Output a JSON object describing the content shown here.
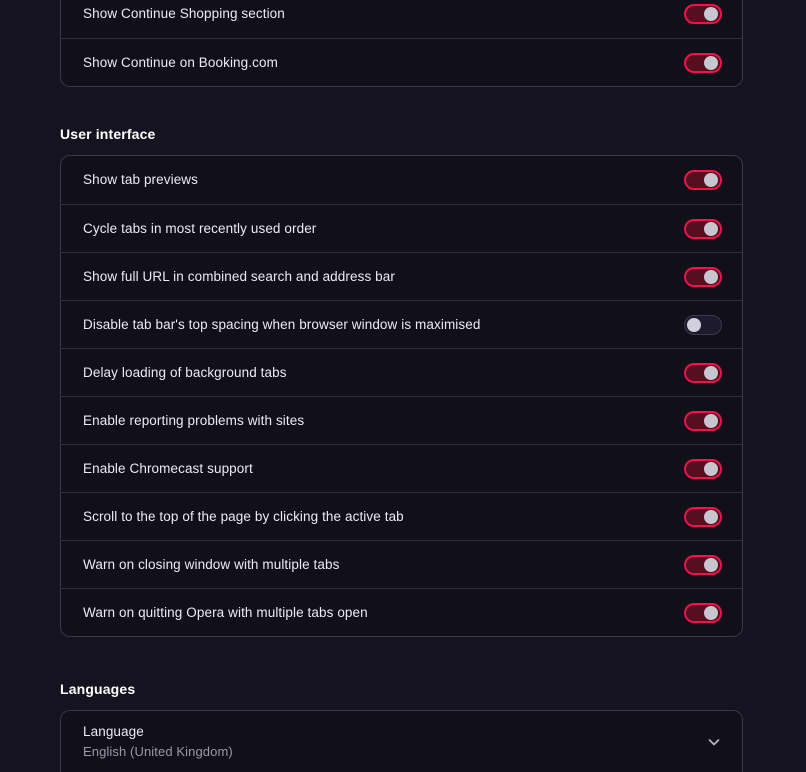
{
  "theme": {
    "page_background": "#15131f",
    "card_background": "#110f19",
    "card_border": "#393947",
    "divider": "#2e2e3a",
    "accent_on": "#f0124a",
    "accent_on_fill": "#54101f",
    "toggle_off_fill": "#1c1a2c",
    "knob": "#c9c6d2",
    "text_primary": "#eceaf2",
    "text_secondary": "#9a98a8"
  },
  "cards": {
    "start_page": {
      "rows": [
        {
          "label": "Show Continue Shopping section",
          "toggle": "on"
        },
        {
          "label": "Show Continue on Booking.com",
          "toggle": "on"
        }
      ]
    },
    "user_interface": {
      "heading": "User interface",
      "rows": [
        {
          "label": "Show tab previews",
          "toggle": "on"
        },
        {
          "label": "Cycle tabs in most recently used order",
          "toggle": "on"
        },
        {
          "label": "Show full URL in combined search and address bar",
          "toggle": "on"
        },
        {
          "label": "Disable tab bar's top spacing when browser window is maximised",
          "toggle": "off"
        },
        {
          "label": "Delay loading of background tabs",
          "toggle": "on"
        },
        {
          "label": "Enable reporting problems with sites",
          "toggle": "on"
        },
        {
          "label": "Enable Chromecast support",
          "toggle": "on"
        },
        {
          "label": "Scroll to the top of the page by clicking the active tab",
          "toggle": "on"
        },
        {
          "label": "Warn on closing window with multiple tabs",
          "toggle": "on"
        },
        {
          "label": "Warn on quitting Opera with multiple tabs open",
          "toggle": "on"
        }
      ]
    },
    "languages": {
      "heading": "Languages",
      "rows": [
        {
          "label": "Language",
          "value": "English (United Kingdom)",
          "control": "chevron-down-icon"
        }
      ]
    }
  }
}
